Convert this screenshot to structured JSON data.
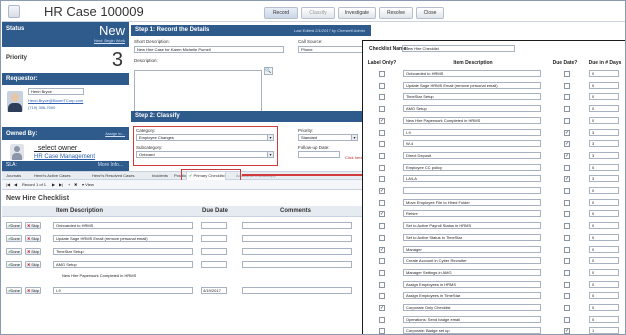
{
  "header": {
    "title": "HR Case 100009",
    "buttons": [
      "Record",
      "Classify",
      "Investigate",
      "Resolve",
      "Close"
    ]
  },
  "left": {
    "status_label": "Status",
    "status_value": "New",
    "status_link": "Next: Begin Work",
    "priority_label": "Priority",
    "priority_value": "3",
    "requestor_label": "Requestor:",
    "requestor_name": "Henri Bryce",
    "requestor_email": "Henri.Bryce@BoomTCorp.com",
    "requestor_phone": "(719) 396-7000",
    "owned_label": "Owned By:",
    "assign_link": "Assign to...",
    "owner_select": "_select owner_",
    "owner_team": "HR Case Management",
    "sla_label": "SLA:",
    "sla_more": "More Info..."
  },
  "center": {
    "step1_title": "Step 1: Record the Details",
    "step1_edited": "Last Edited 2/1/2017 by Cherwell Admin",
    "short_desc_label": "Short Description:",
    "short_desc_value": "New Hire Case for Karen Michelle Pumell",
    "call_source_label": "Call Source:",
    "call_source_value": "Phone",
    "description_label": "Description:",
    "step2_title": "Step 2: Classify",
    "category_label": "Category:",
    "category_value": "Employee Changes",
    "subcategory_label": "Subcategory:",
    "subcategory_value": "Onboard",
    "priority_label": "Priority:",
    "priority_value": "Standard",
    "followup_label": "Follow-up Date:",
    "click_here": "Click here"
  },
  "tabs": [
    "Journals",
    "Henri's Active Cases",
    "Henri's Resolved Cases",
    "Incidents",
    "Position",
    "Primary Checklist",
    "Additional Checklist(s)"
  ],
  "toolbar": {
    "record_text": "Record 1 of 1",
    "view_label": "View"
  },
  "lower": {
    "title": "New Hire Checklist",
    "col_item": "Item Description",
    "col_due": "Due Date",
    "col_comments": "Comments",
    "done_label": "Done",
    "skip_label": "Skip",
    "rows": [
      {
        "item": "Onboarded to HRMS",
        "date": ""
      },
      {
        "item": "Update Sage HRMS Email (remove personal email)",
        "date": ""
      },
      {
        "item": "TimeStar Setup",
        "date": ""
      },
      {
        "item": "AMG Setup",
        "date": ""
      },
      {
        "item": "New Hire Paperwork Completed in HRMS",
        "date": ""
      },
      {
        "item": "I-9",
        "date": "4/19/2017"
      }
    ]
  },
  "overlay": {
    "name_label": "Checklist Name:",
    "name_value": "New Hire Checklist",
    "col_label_only": "Label Only?",
    "col_item": "Item Description",
    "col_due": "Due Date?",
    "col_days": "Due in # Days",
    "rows": [
      {
        "desc": "Onboarded to HRMS",
        "label": false,
        "due": false,
        "days": "0"
      },
      {
        "desc": "Update Sage HRMS Email (remove personal email)",
        "label": false,
        "due": false,
        "days": "0"
      },
      {
        "desc": "TimeStar Setup",
        "label": false,
        "due": false,
        "days": "0"
      },
      {
        "desc": "AMG Setup",
        "label": false,
        "due": false,
        "days": "0"
      },
      {
        "desc": "New Hire Paperwork Completed in HRMS",
        "label": true,
        "due": false,
        "days": "0"
      },
      {
        "desc": "I-9",
        "label": false,
        "due": true,
        "days": "3"
      },
      {
        "desc": "W-4",
        "label": false,
        "due": true,
        "days": "3"
      },
      {
        "desc": "Direct Deposit",
        "label": false,
        "due": true,
        "days": "3"
      },
      {
        "desc": "Employee CC policy",
        "label": false,
        "due": false,
        "days": "0"
      },
      {
        "desc": "LA/LA",
        "label": false,
        "due": true,
        "days": "3"
      },
      {
        "desc": "",
        "label": true,
        "due": false,
        "days": "0"
      },
      {
        "desc": "Move Employee File to Hired Folder",
        "label": false,
        "due": false,
        "days": "0"
      },
      {
        "desc": "Rehire",
        "label": true,
        "due": false,
        "days": "0"
      },
      {
        "desc": "Set to Active Payroll Status in HRMS",
        "label": false,
        "due": false,
        "days": "0"
      },
      {
        "desc": "Set to Active Status in TimeStar",
        "label": false,
        "due": false,
        "days": "0"
      },
      {
        "desc": "Manager",
        "label": true,
        "due": false,
        "days": "0"
      },
      {
        "desc": "Create Account in Cyber Recruiter",
        "label": false,
        "due": false,
        "days": "0"
      },
      {
        "desc": "Manager Settings in AMG",
        "label": false,
        "due": false,
        "days": "0"
      },
      {
        "desc": "Assign Employees in HRMS",
        "label": false,
        "due": false,
        "days": "0"
      },
      {
        "desc": "Assign Employees in TimeStar",
        "label": false,
        "due": false,
        "days": "0"
      },
      {
        "desc": "Corporate Only Checklist",
        "label": true,
        "due": false,
        "days": "0"
      },
      {
        "desc": "Operations: Send badge email",
        "label": false,
        "due": false,
        "days": "0"
      },
      {
        "desc": "Corporate: Badge set up",
        "label": false,
        "due": true,
        "days": "1"
      }
    ]
  },
  "colors": {
    "panel_blue": "#2f5a8c",
    "highlight_red": "#d03a3a"
  }
}
